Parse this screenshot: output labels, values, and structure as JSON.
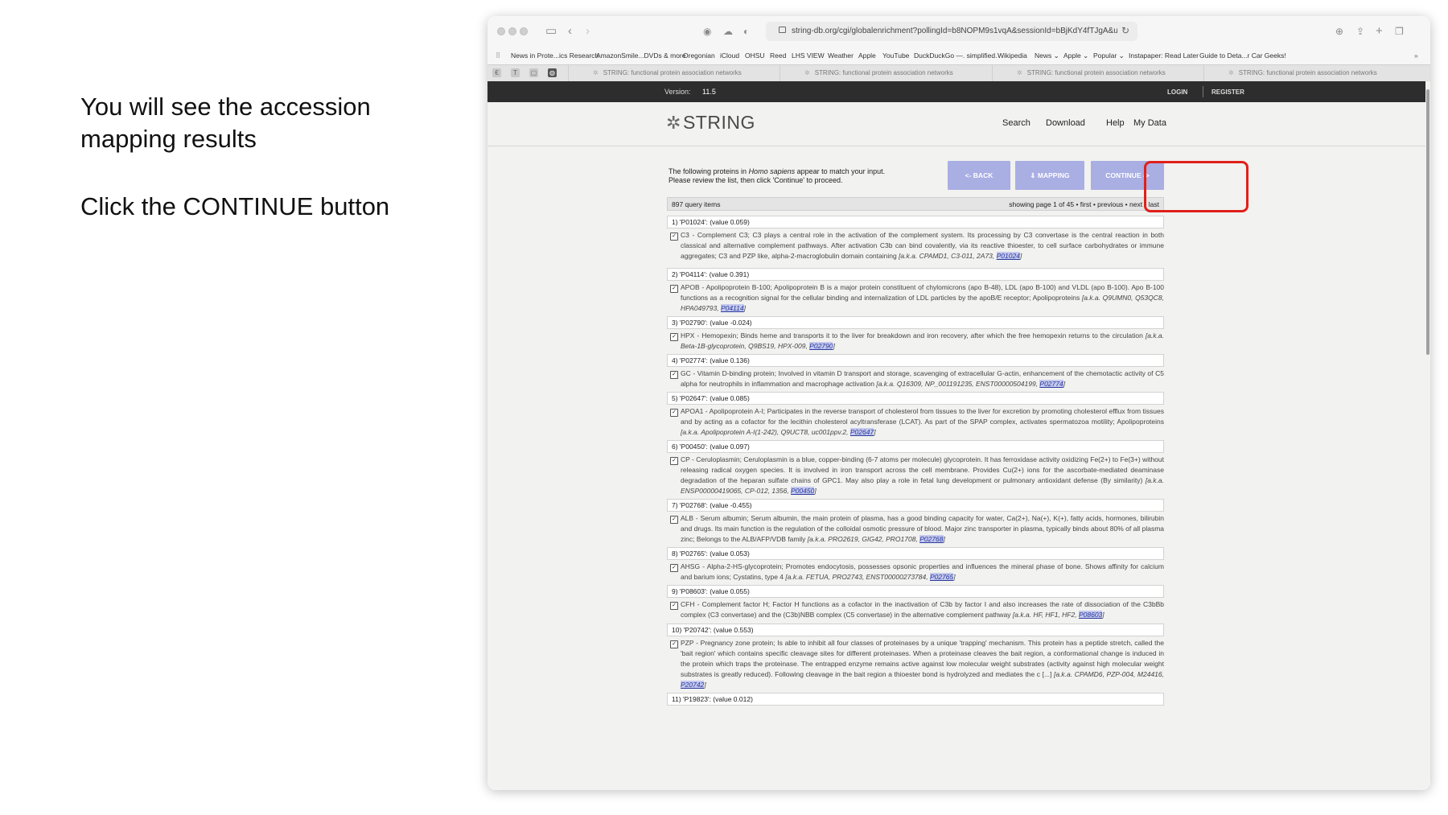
{
  "instructions": {
    "line1": "You will see the accession mapping results",
    "line2": "Click the CONTINUE button"
  },
  "browser": {
    "url": "string-db.org/cgi/globalenrichment?pollingId=b8NOPM9s1vqA&sessionId=bBjKdY4fTJgA&ur",
    "bookmarks": [
      "News in Prote...ics Research",
      "AmazonSmile...DVDs & more",
      "Oregonian",
      "iCloud",
      "OHSU",
      "Reed",
      "LHS VIEW",
      "Weather",
      "Apple",
      "YouTube",
      "DuckDuckGo —. simplified.",
      "Wikipedia",
      "News ⌄",
      "Apple ⌄",
      "Popular ⌄",
      "Instapaper: Read Later",
      "Guide to Deta...r Car Geeks!"
    ],
    "tabs": [
      "STRING: functional protein association networks",
      "STRING: functional protein association networks",
      "STRING: functional protein association networks",
      "STRING: functional protein association networks"
    ]
  },
  "string": {
    "version_label": "Version:",
    "version": "11.5",
    "login": "LOGIN",
    "register": "REGISTER",
    "logo": "STRING",
    "nav": {
      "search": "Search",
      "download": "Download",
      "help": "Help",
      "mydata": "My Data"
    },
    "match_pre": "The following proteins in ",
    "organism": "Homo sapiens",
    "match_post": " appear to match your input.",
    "match_line2": "Please review the list, then click 'Continue' to proceed.",
    "buttons": {
      "back": "<- BACK",
      "mapping": "⇓ MAPPING",
      "continue": "CONTINUE ->"
    },
    "query_count": "897 query items",
    "pagination": "showing page 1 of 45 • first • previous • next • last"
  },
  "items": [
    {
      "head": "1) 'P01024':  (value 0.059)",
      "text": "C3 - Complement C3; C3 plays a central role in the activation of the complement system. Its processing by C3 convertase is the central reaction in both classical and alternative complement pathways. After activation C3b can bind covalently, via its reactive thioester, to cell surface carbohydrates or immune aggregates; C3 and PZP like, alpha-2-macroglobulin domain containing ",
      "aka": "[a.k.a. CPAMD1, C3-011, 2A73, ",
      "acc": "P01024",
      "end": "]"
    },
    {
      "head": "2) 'P04114':  (value 0.391)",
      "text": "APOB - Apolipoprotein B-100; Apolipoprotein B is a major protein constituent of chylomicrons (apo B-48), LDL (apo B-100) and VLDL (apo B-100). Apo B-100 functions as a recognition signal for the cellular binding and internalization of LDL particles by the apoB/E receptor; Apolipoproteins ",
      "aka": "[a.k.a. Q9UMN0, Q53QC8, HPA049793, ",
      "acc": "P04114",
      "end": "]"
    },
    {
      "head": "3) 'P02790':  (value -0.024)",
      "text": "HPX - Hemopexin; Binds heme and transports it to the liver for breakdown and iron recovery, after which the free hemopexin returns to the circulation ",
      "aka": "[a.k.a. Beta-1B-glycoprotein, Q9BS19, HPX-009, ",
      "acc": "P02790",
      "end": "]"
    },
    {
      "head": "4) 'P02774':  (value 0.136)",
      "text": "GC - Vitamin D-binding protein; Involved in vitamin D transport and storage, scavenging of extracellular G-actin, enhancement of the chemotactic activity of C5 alpha for neutrophils in inflammation and macrophage activation ",
      "aka": "[a.k.a. Q16309, NP_001191235, ENST00000504199, ",
      "acc": "P02774",
      "end": "]"
    },
    {
      "head": "5) 'P02647':  (value 0.085)",
      "text": "APOA1 - Apolipoprotein A-I; Participates in the reverse transport of cholesterol from tissues to the liver for excretion by promoting cholesterol efflux from tissues and by acting as a cofactor for the lecithin cholesterol acyltransferase (LCAT). As part of the SPAP complex, activates spermatozoa motility; Apolipoproteins ",
      "aka": "[a.k.a. Apolipoprotein A-I(1-242), Q9UCT8, uc001ppv.2, ",
      "acc": "P02647",
      "end": "]"
    },
    {
      "head": "6) 'P00450':  (value 0.097)",
      "text": "CP - Ceruloplasmin; Ceruloplasmin is a blue, copper-binding (6-7 atoms per molecule) glycoprotein. It has ferroxidase activity oxidizing Fe(2+) to Fe(3+) without releasing radical oxygen species. It is involved in iron transport across the cell membrane. Provides Cu(2+) ions for the ascorbate-mediated deaminase degradation of the heparan sulfate chains of GPC1. May also play a role in fetal lung development or pulmonary antioxidant defense (By similarity) ",
      "aka": "[a.k.a. ENSP00000419065, CP-012, 1356, ",
      "acc": "P00450",
      "end": "]"
    },
    {
      "head": "7) 'P02768':  (value -0.455)",
      "text": "ALB - Serum albumin; Serum albumin, the main protein of plasma, has a good binding capacity for water, Ca(2+), Na(+), K(+), fatty acids, hormones, bilirubin and drugs. Its main function is the regulation of the colloidal osmotic pressure of blood. Major zinc transporter in plasma, typically binds about 80% of all plasma zinc; Belongs to the ALB/AFP/VDB family ",
      "aka": "[a.k.a. PRO2619, GIG42, PRO1708, ",
      "acc": "P02768",
      "end": "]"
    },
    {
      "head": "8) 'P02765':  (value 0.053)",
      "text": "AHSG - Alpha-2-HS-glycoprotein; Promotes endocytosis, possesses opsonic properties and influences the mineral phase of bone. Shows affinity for calcium and barium ions; Cystatins, type 4 ",
      "aka": "[a.k.a. FETUA, PRO2743, ENST00000273784, ",
      "acc": "P02765",
      "end": "]"
    },
    {
      "head": "9) 'P08603':  (value 0.055)",
      "text": "CFH - Complement factor H; Factor H functions as a cofactor in the inactivation of C3b by factor I and also increases the rate of dissociation of the C3bBb complex (C3 convertase) and the (C3b)NBB complex (C5 convertase) in the alternative complement pathway ",
      "aka": "[a.k.a. HF, HF1, HF2, ",
      "acc": "P08603",
      "end": "]"
    },
    {
      "head": "10) 'P20742':  (value 0.553)",
      "text": "PZP - Pregnancy zone protein; Is able to inhibit all four classes of proteinases by a unique 'trapping' mechanism. This protein has a peptide stretch, called the 'bait region' which contains specific cleavage sites for different proteinases. When a proteinase cleaves the bait region, a conformational change is induced in the protein which traps the proteinase. The entrapped enzyme remains active against low molecular weight substrates (activity against high molecular weight substrates is greatly reduced). Following cleavage in the bait region a thioester bond is hydrolyzed and mediates the c [...] ",
      "aka": "[a.k.a. CPAMD6, PZP-004, M24416, ",
      "acc": "P20742",
      "end": "]"
    },
    {
      "head": "11) 'P19823':  (value 0.012)",
      "text": "",
      "aka": "",
      "acc": "",
      "end": ""
    }
  ]
}
